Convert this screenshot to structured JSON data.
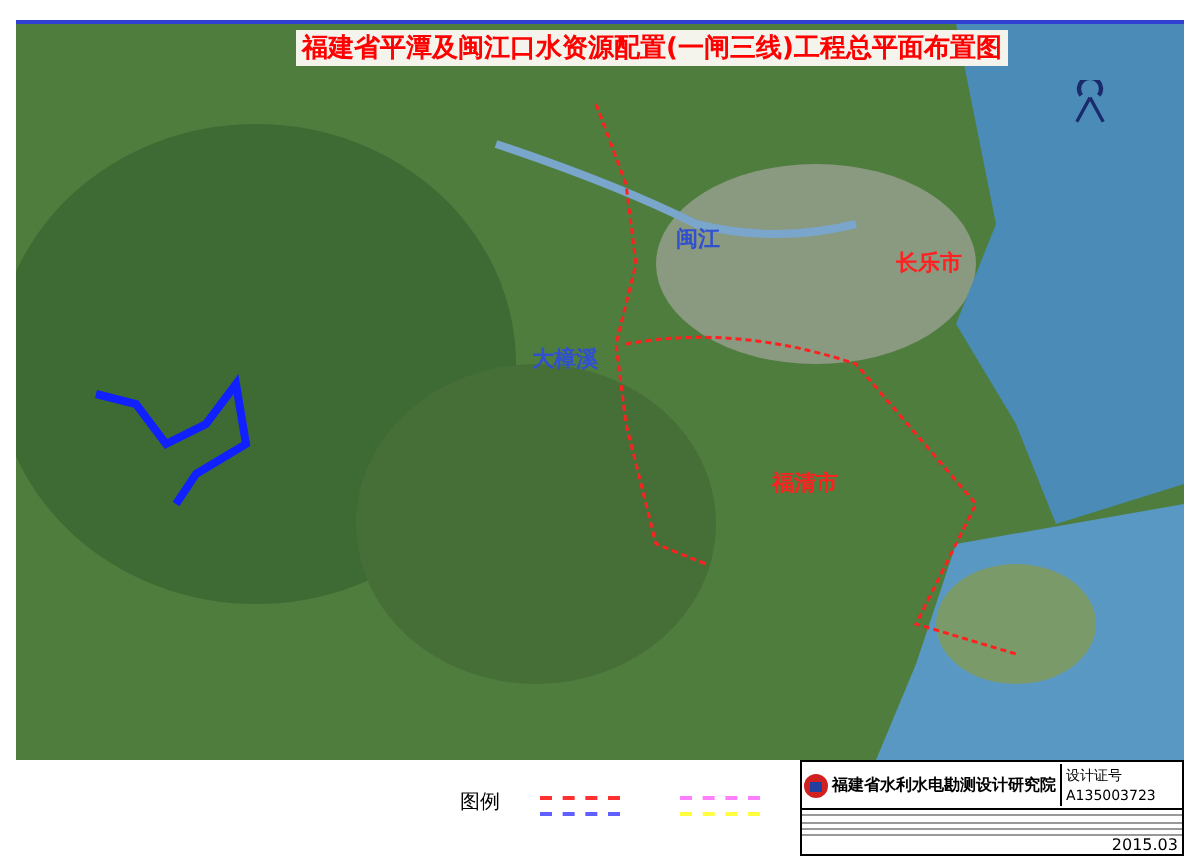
{
  "title": "福建省平潭及闽江口水资源配置(一闸三线)工程总平面布置图",
  "map_labels": [
    {
      "text": "闽江",
      "color": "#3050d0"
    },
    {
      "text": "大樟溪",
      "color": "#3050d0"
    },
    {
      "text": "长乐市",
      "color": "#ff2020"
    },
    {
      "text": "福清市",
      "color": "#ff2020"
    }
  ],
  "legend": {
    "title": "图例",
    "items": [
      {
        "color": "#ff3030"
      },
      {
        "color": "#ff80ff"
      },
      {
        "color": "#6060ff"
      },
      {
        "color": "#ffff40"
      }
    ]
  },
  "title_block": {
    "institute": "福建省水利水电勘测设计研究院",
    "cert_label": "设计证号",
    "cert_no": "A135003723",
    "date": "2015.03"
  }
}
